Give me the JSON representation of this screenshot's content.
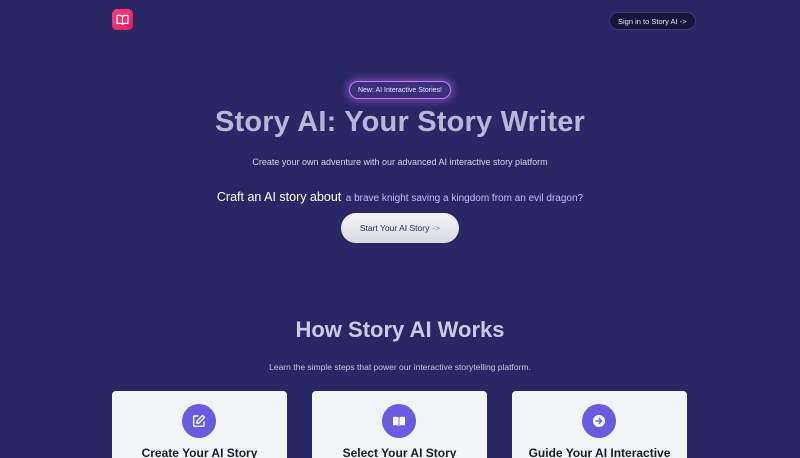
{
  "header": {
    "logo_icon": "open-book-icon",
    "signin_label": "Sign in to Story AI ->"
  },
  "hero": {
    "badge": "New: AI Interactive Stories!",
    "title": "Story AI: Your Story Writer",
    "subtitle": "Create your own adventure with our advanced AI interactive story platform",
    "craft_lead": "Craft an AI story about",
    "craft_prompt": "a brave knight saving a kingdom from an evil dragon?",
    "start_label": "Start Your AI Story",
    "start_arrow": "->"
  },
  "how": {
    "title": "How Story AI Works",
    "subtitle": "Learn the simple steps that power our interactive storytelling platform."
  },
  "cards": [
    {
      "title": "Create Your AI Story",
      "icon": "edit-icon"
    },
    {
      "title": "Select Your AI Story",
      "icon": "book-icon"
    },
    {
      "title": "Guide Your AI Interactive",
      "icon": "arrow-circle-icon"
    }
  ],
  "colors": {
    "background": "#2a2766",
    "logo": "#e01e5a",
    "accent": "#6a5be2",
    "card": "#f3f4f8"
  }
}
